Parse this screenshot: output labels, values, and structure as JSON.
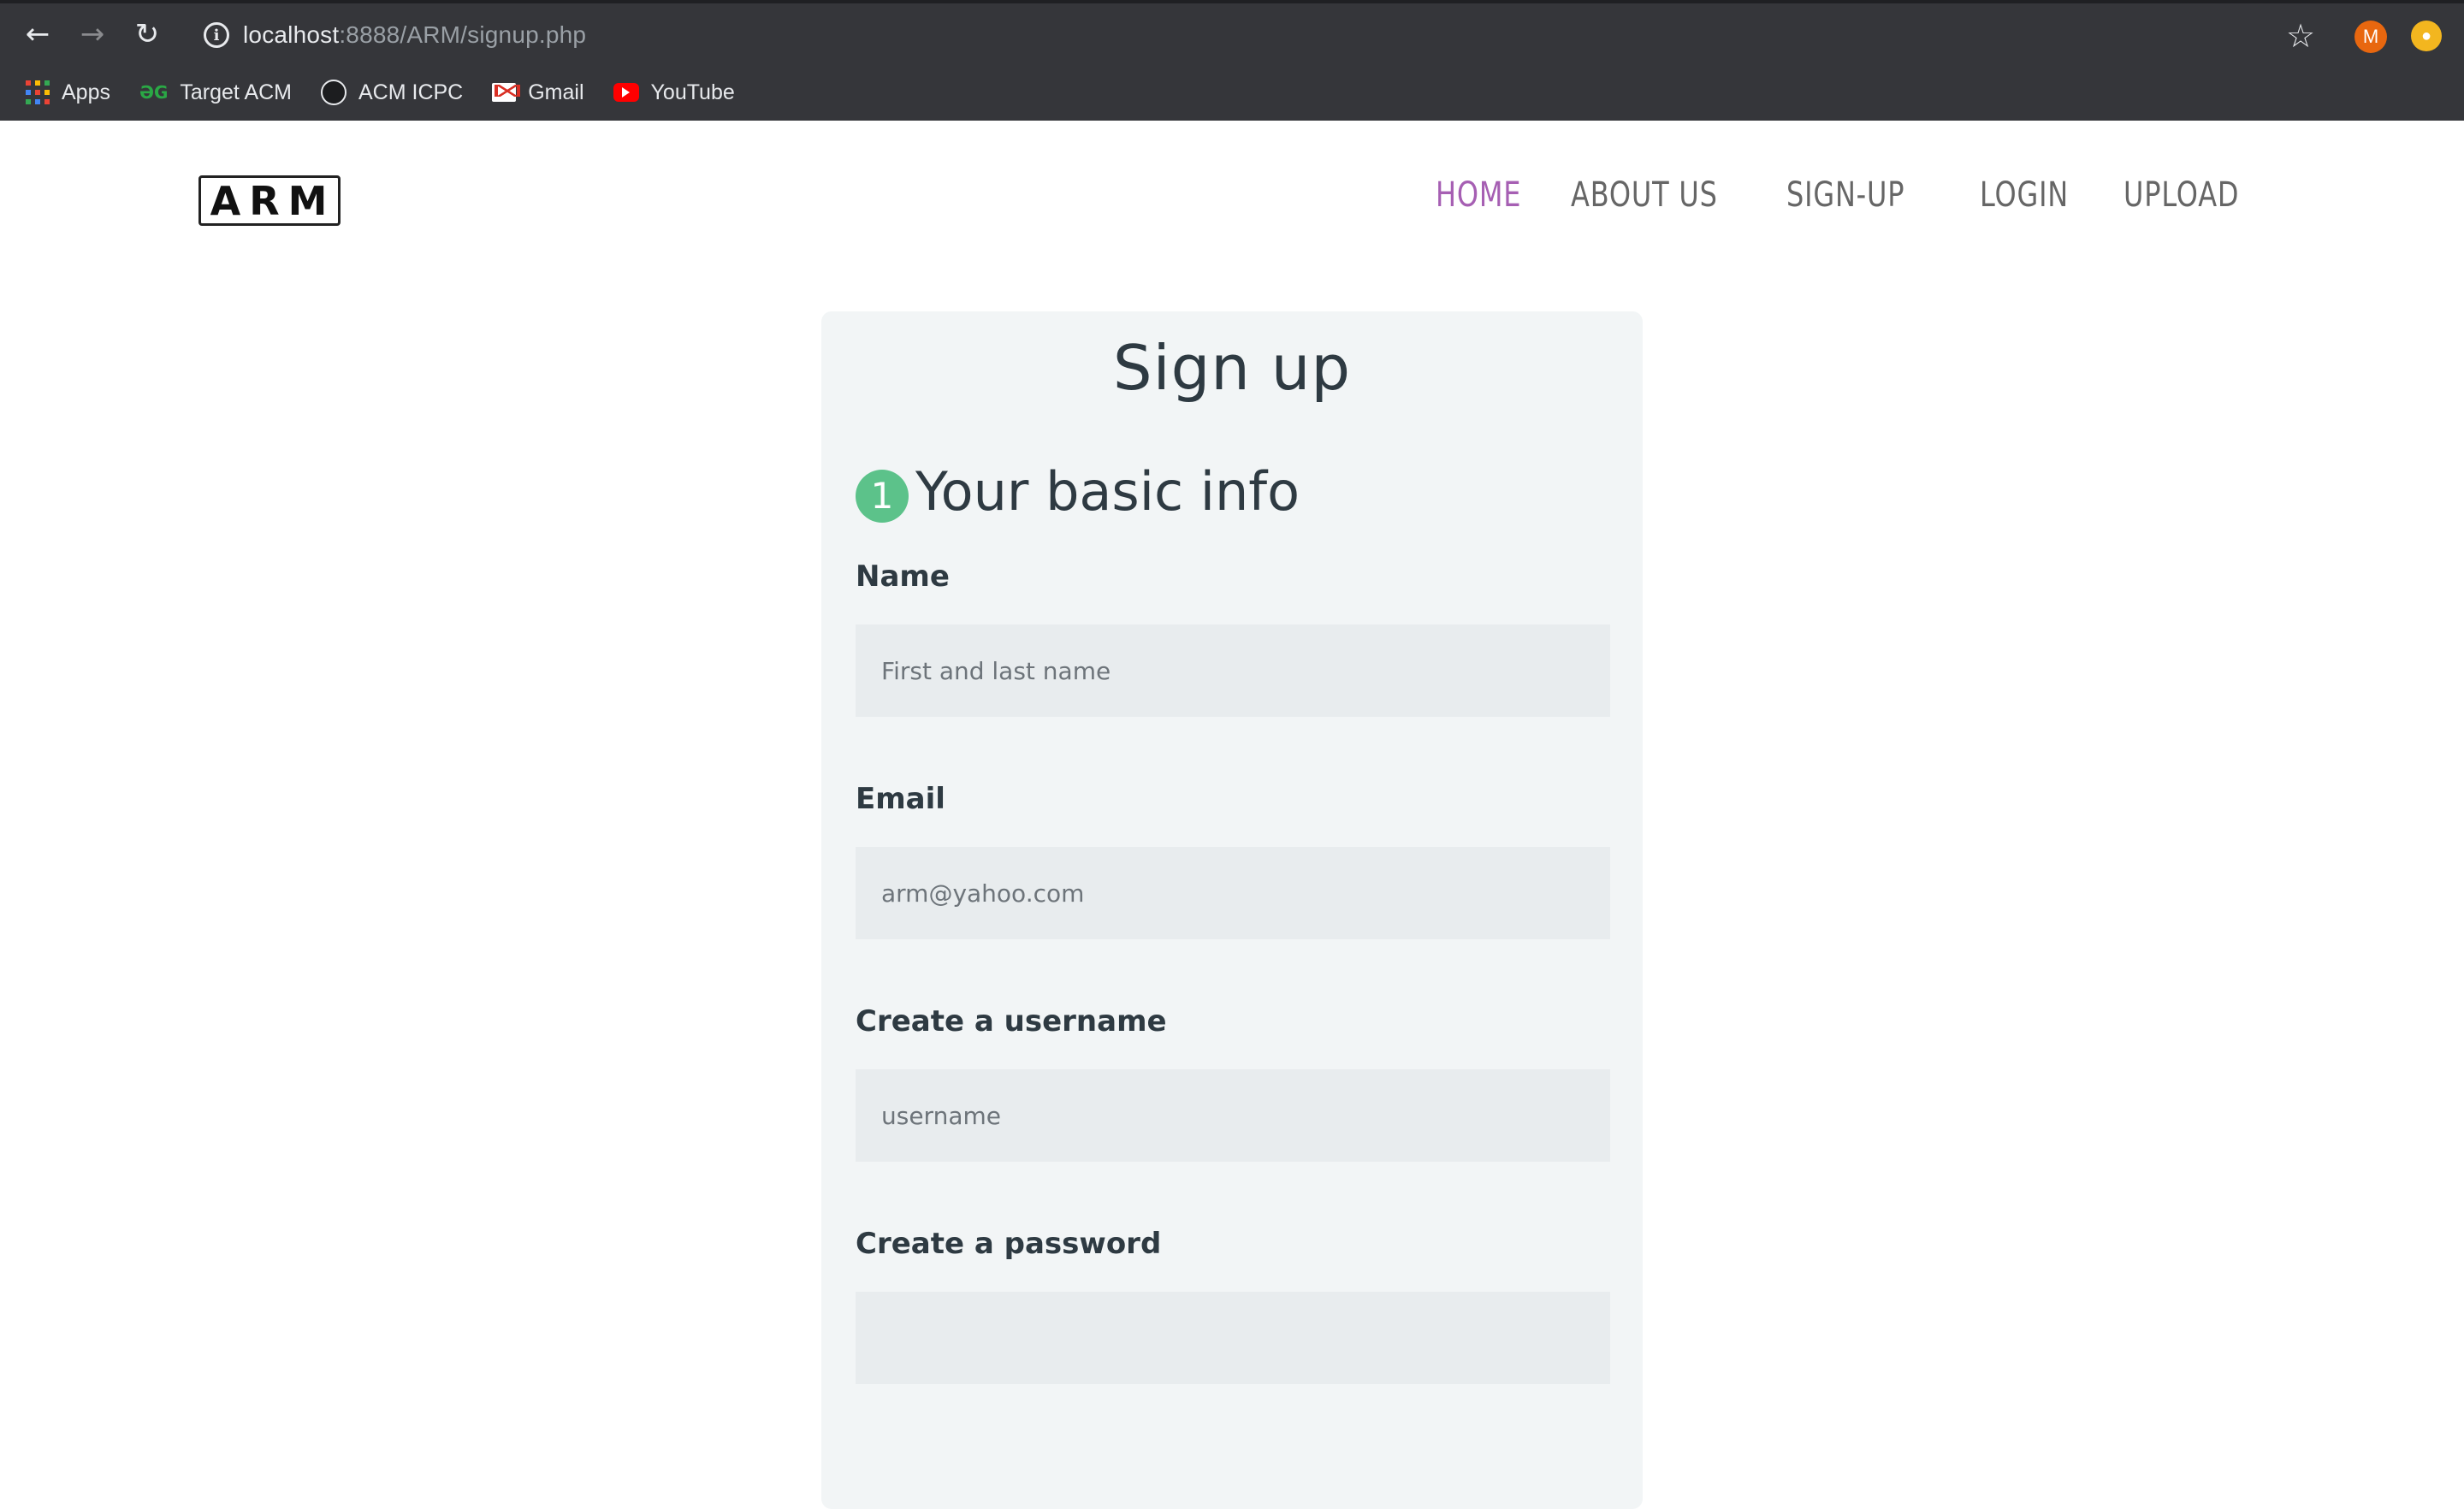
{
  "browser": {
    "url_host": "localhost",
    "url_path": ":8888/ARM/signup.php",
    "avatar_letter": "M",
    "bookmarks": [
      {
        "label": "Apps",
        "icon": "apps-grid-icon"
      },
      {
        "label": "Target ACM",
        "icon": "geeksforgeeks-icon"
      },
      {
        "label": "ACM ICPC",
        "icon": "github-icon"
      },
      {
        "label": "Gmail",
        "icon": "gmail-icon"
      },
      {
        "label": "YouTube",
        "icon": "youtube-icon"
      }
    ]
  },
  "site": {
    "logo": "ARM",
    "nav": [
      {
        "label": "HOME",
        "active": true
      },
      {
        "label": "ABOUT US",
        "active": false
      },
      {
        "label": "SIGN-UP",
        "active": false
      },
      {
        "label": "LOGIN",
        "active": false
      },
      {
        "label": "UPLOAD",
        "active": false
      }
    ]
  },
  "form": {
    "title": "Sign up",
    "step_number": "1",
    "step_title": "Your basic info",
    "fields": [
      {
        "label": "Name",
        "placeholder": "First and last name",
        "value": ""
      },
      {
        "label": "Email",
        "placeholder": "arm@yahoo.com",
        "value": ""
      },
      {
        "label": "Create a username",
        "placeholder": "username",
        "value": ""
      },
      {
        "label": "Create a password",
        "placeholder": "",
        "value": ""
      }
    ]
  },
  "colors": {
    "nav_active": "#a65fb3",
    "step_badge": "#5cc28a",
    "card_bg": "#f2f5f6",
    "input_bg": "#e8ecee"
  }
}
